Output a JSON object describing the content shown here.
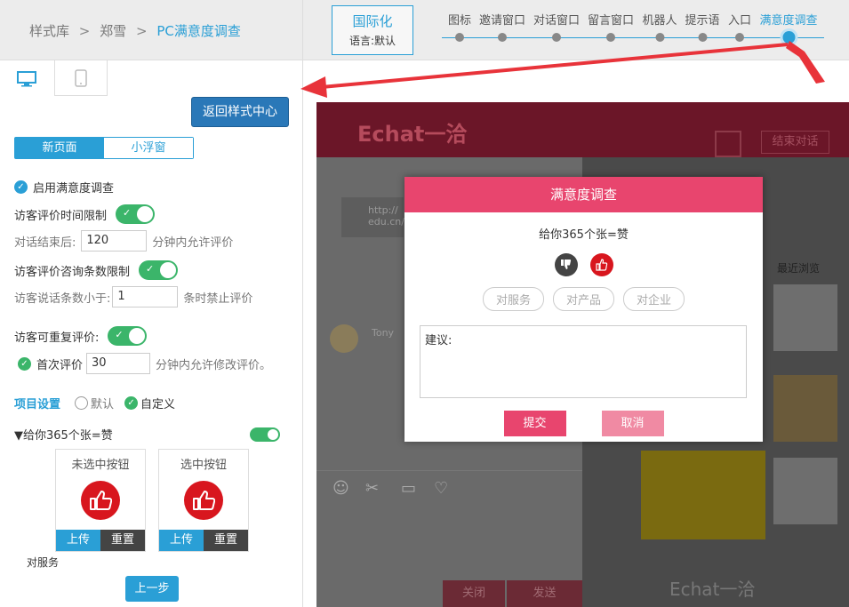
{
  "breadcrumb": {
    "root": "样式库",
    "sep": ">",
    "mid": "郑雪",
    "current": "PC满意度调查"
  },
  "intl": {
    "title": "国际化",
    "lang": "语言:默认"
  },
  "steps": [
    {
      "label": "图标"
    },
    {
      "label": "邀请窗口"
    },
    {
      "label": "对话窗口"
    },
    {
      "label": "留言窗口"
    },
    {
      "label": "机器人"
    },
    {
      "label": "提示语"
    },
    {
      "label": "入口"
    },
    {
      "label": "满意度调查",
      "active": true
    }
  ],
  "left": {
    "back_button": "返回样式中心",
    "mode_tabs": {
      "new_page": "新页面",
      "float": "小浮窗"
    },
    "enable_survey": "启用满意度调查",
    "time_limit": {
      "label": "访客评价时间限制",
      "after_label": "对话结束后:",
      "value": "120",
      "suffix": "分钟内允许评价"
    },
    "count_limit": {
      "label": "访客评价咨询条数限制",
      "before_label": "访客说话条数小于:",
      "value": "1",
      "suffix": "条时禁止评价"
    },
    "repeat": {
      "label": "访客可重复评价:",
      "first_label": "首次评价",
      "value": "30",
      "suffix": "分钟内允许修改评价。"
    },
    "project": {
      "label": "项目设置",
      "default": "默认",
      "custom": "自定义"
    },
    "item": {
      "title": "▼给你365个张=赞"
    },
    "cards": [
      {
        "title": "未选中按钮",
        "upload": "上传",
        "reset": "重置"
      },
      {
        "title": "选中按钮",
        "upload": "上传",
        "reset": "重置"
      }
    ],
    "tag_label": "对服务",
    "prev_button": "上一步"
  },
  "preview": {
    "logo": "Echat一洽",
    "end_button": "结束对话",
    "modal": {
      "title": "满意度调查",
      "question": "给你365个张=赞",
      "tags": [
        "对服务",
        "对产品",
        "对企业"
      ],
      "suggestion": "建议:",
      "submit": "提交",
      "cancel": "取消"
    },
    "bg_texts": {
      "url": "http://",
      "url2": "edu.cn/",
      "visitor": "Tony",
      "right_title": "最近浏览",
      "close": "关闭",
      "send": "发送"
    }
  },
  "colors": {
    "accent": "#2a9fd6",
    "pink": "#e8456e",
    "green": "#3bb56a",
    "red": "#d8161e"
  }
}
